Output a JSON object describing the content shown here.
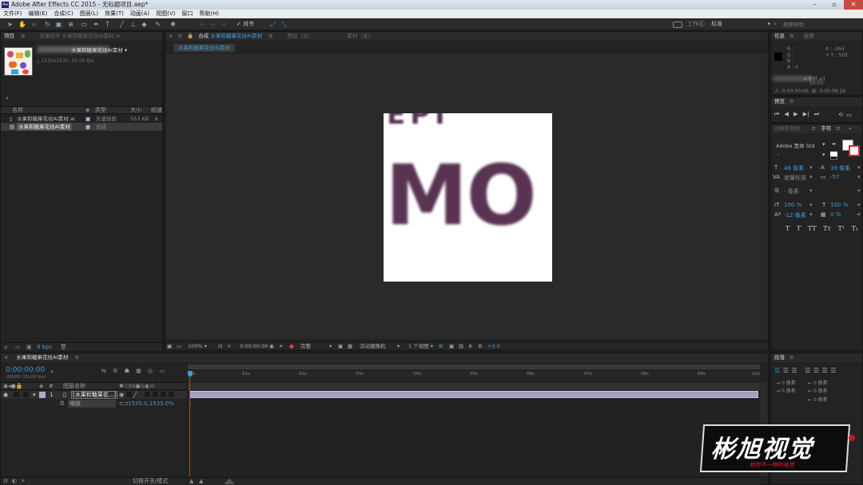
{
  "title": "Adobe After Effects CC 2015 - 无标题项目.aep*",
  "menu": [
    "文件(F)",
    "编辑(E)",
    "合成(C)",
    "图层(L)",
    "效果(T)",
    "动画(A)",
    "视图(V)",
    "窗口",
    "帮助(H)"
  ],
  "toolbar": {
    "snap_label": "对齐",
    "workspace_label": "工作区:",
    "workspace_value": "标准",
    "search_placeholder": "搜索帮助"
  },
  "project": {
    "tab": "项目",
    "effects_tab": "效果控件 水果和糖果花纹AI素材.ai",
    "preview_name": "水果和糖果花纹AI素材 ▾",
    "preview_info": "△ 1535x1535, 25.00 fps",
    "columns": [
      "名称",
      "类型",
      "大小",
      "帧速"
    ],
    "items": [
      {
        "name": "水果和糖果花纹AI素材.ai",
        "type": "矢量插画",
        "size": "553 KB"
      },
      {
        "name": "水果和糖果花纹AI素材",
        "type": "合成",
        "size": ""
      }
    ],
    "bpc": "8 bpc"
  },
  "comp": {
    "tab_comp": "合成",
    "comp_name": "水果和糖果花纹AI素材",
    "tab_layer": "图层（无）",
    "tab_footage": "素材（无）",
    "flowchart_label": "水果和糖果花纹AI素材",
    "canvas_text": "MO",
    "bottom": {
      "zoom": "100%",
      "timecode": "0:00:00:00",
      "quality": "完整",
      "camera": "活动摄像机",
      "views": "1 个视图",
      "exposure": "+0.0"
    }
  },
  "info": {
    "tab": "信息",
    "audio_tab": "音频",
    "r": "R :",
    "g": "G :",
    "b": "B :",
    "a": "A : 0",
    "x": "X : -264",
    "y": "+ Y : 502",
    "file": "AI素材.ai]",
    "dur1": "10:00",
    "dur2": "入: 0:00:00:00, 出: 0:00:09:24"
  },
  "preview": {
    "tab": "预览"
  },
  "character": {
    "effects_tab": "效果和预设",
    "char_tab": "字符",
    "font": "Adobe 黑体 Std",
    "style": "-",
    "size": "46 像素",
    "leading": "39 像素",
    "kern": "度量标准",
    "track": "-57",
    "stroke": "- 像素",
    "vscale": "100 %",
    "hscale": "100 %",
    "baseline": "-12 像素",
    "tsume": "0 %"
  },
  "paragraph": {
    "tab": "段落",
    "v1": "0 像素",
    "v2": "0 像素",
    "v3": "0 像素",
    "v4": "0 像素",
    "v5": "0 像素"
  },
  "timeline": {
    "tab": "水果和糖果花纹AI素材",
    "timecode": "0:00:00:00",
    "fps": "00000 (25.00 fps)",
    "col_layer": "图层名称",
    "layer_num": "1",
    "layer_name": "[水果和糖果花...]",
    "prop": "缩放",
    "prop_value": "1535.0,1535.0%",
    "ticks": [
      "0s",
      "01s",
      "02s",
      "03s",
      "04s",
      "05s",
      "06s",
      "07s",
      "08s",
      "09s",
      "10s"
    ],
    "switch_mode": "切换开关/模式"
  },
  "watermark": {
    "text": "彬旭视觉",
    "sub": "给你不一样的视觉"
  }
}
